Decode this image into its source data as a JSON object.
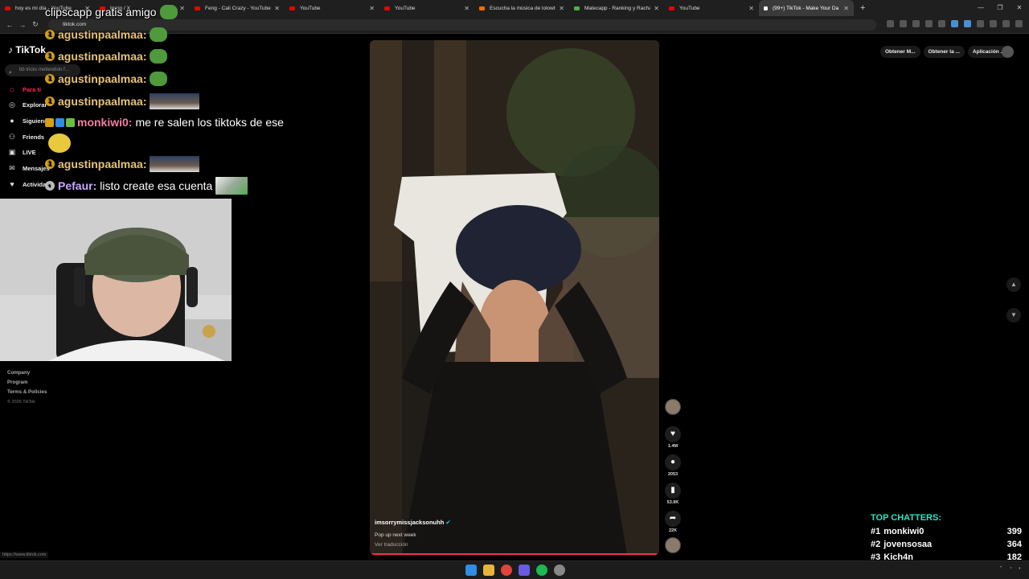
{
  "browser": {
    "tabs": [
      {
        "title": "hoy es mi día - YouTube",
        "icon": "youtube"
      },
      {
        "title": "Inicio / X",
        "icon": "x"
      },
      {
        "title": "Feng - Cali Crazy - YouTube",
        "icon": "youtube"
      },
      {
        "title": "YouTube",
        "icon": "youtube"
      },
      {
        "title": "YouTube",
        "icon": "youtube"
      },
      {
        "title": "Escucha la música de lolowtf | S",
        "icon": "soundcloud"
      },
      {
        "title": "Matecapp - Ranking y Racha d",
        "icon": "matecapp"
      },
      {
        "title": "YouTube",
        "icon": "youtube"
      },
      {
        "title": "(99+) TikTok - Make Your Da",
        "icon": "tiktok",
        "active": true
      }
    ],
    "url": "tiktok.com",
    "status_url": "https://www.tiktok.com"
  },
  "tiktok": {
    "logo": "TikTok",
    "search_placeholder": "bb tricks metiendolo f...",
    "nav": [
      {
        "label": "Para ti",
        "icon": "home-icon",
        "active": true
      },
      {
        "label": "Explorar",
        "icon": "compass-icon"
      },
      {
        "label": "Siguiendo",
        "icon": "following-icon"
      },
      {
        "label": "Friends",
        "icon": "friends-icon"
      },
      {
        "label": "LIVE",
        "icon": "live-icon"
      },
      {
        "label": "Mensajes",
        "icon": "messages-icon"
      },
      {
        "label": "Actividad",
        "icon": "activity-icon"
      }
    ],
    "footer": {
      "company": "Company",
      "program": "Program",
      "terms": "Terms & Policies",
      "copyright": "© 2026 TikTok"
    },
    "top_buttons": [
      "Obtener M...",
      "Obtener la ...",
      "Aplicación ..."
    ],
    "video": {
      "creator": "imsorrymissjacksonuhh",
      "caption": "Pop up next week",
      "translate": "Ver traducción"
    },
    "actions": {
      "likes": "1.4M",
      "comments": "2053",
      "saves": "53.9K",
      "shares": "22K"
    }
  },
  "stream": {
    "chat": [
      {
        "user": "",
        "message": "clipscapp gratis amigo",
        "emote": "pepe"
      },
      {
        "user": "agustinpaalmaa:",
        "message": "",
        "emote": "pepe"
      },
      {
        "user": "agustinpaalmaa:",
        "message": "",
        "emote": "pepe"
      },
      {
        "user": "agustinpaalmaa:",
        "message": "",
        "emote": "pepe"
      },
      {
        "user": "agustinpaalmaa:",
        "message": "",
        "emote": "image"
      },
      {
        "user": "monkiwi0:",
        "message": "me re salen los tiktoks de ese",
        "emote": ""
      },
      {
        "user": "",
        "message": "",
        "emote": "face"
      },
      {
        "user": "agustinpaalmaa:",
        "message": "",
        "emote": "image"
      },
      {
        "user": "Pefaur:",
        "message": "listo create esa cuenta",
        "emote": "image2"
      }
    ],
    "top_chatters": {
      "title": "TOP CHATTERS:",
      "rows": [
        {
          "rank": "#1",
          "name": "monkiwi0",
          "count": "399"
        },
        {
          "rank": "#2",
          "name": "jovensosaa",
          "count": "364"
        },
        {
          "rank": "#3",
          "name": "Kich4n",
          "count": "182"
        }
      ]
    }
  },
  "colors": {
    "accent": "#fe2c55",
    "chatters_title": "#32e0c4",
    "badge_gold": "#d4a10f"
  }
}
